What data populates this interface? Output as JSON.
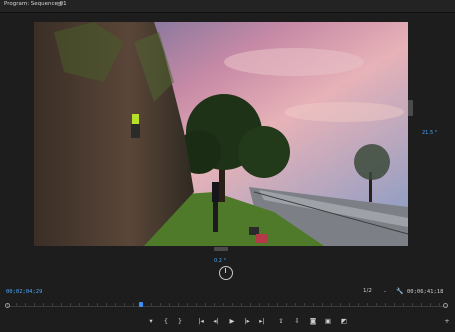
{
  "panel": {
    "title": "Program: Sequence 01",
    "menu_icon": "hamburger-icon",
    "menu_glyph": "≡"
  },
  "viewer": {
    "rotation_right_value": "21.5 °",
    "rotation_bottom_value": "0.2 °"
  },
  "status": {
    "current_timecode": "00;02;04;29",
    "resolution": "1/2",
    "duration_timecode": "00;06;41;18",
    "playhead_fraction": 0.3
  },
  "transport": {
    "buttons": [
      {
        "name": "add-marker-button",
        "glyph": "▾"
      },
      {
        "name": "mark-in-button",
        "glyph": "{"
      },
      {
        "name": "mark-out-button",
        "glyph": "}"
      },
      {
        "name": "go-to-in-button",
        "glyph": "|◂"
      },
      {
        "name": "step-back-button",
        "glyph": "◂|"
      },
      {
        "name": "play-button",
        "glyph": "▶"
      },
      {
        "name": "step-forward-button",
        "glyph": "|▸"
      },
      {
        "name": "go-to-out-button",
        "glyph": "▸|"
      },
      {
        "name": "lift-button",
        "glyph": "⇪"
      },
      {
        "name": "extract-button",
        "glyph": "⇩"
      },
      {
        "name": "export-frame-button",
        "glyph": "◙"
      },
      {
        "name": "comparison-view-button",
        "glyph": "▣"
      },
      {
        "name": "vr-video-button",
        "glyph": "◩"
      },
      {
        "name": "add-button",
        "glyph": "+"
      }
    ]
  },
  "colors": {
    "accent": "#4aa7ff",
    "panel_bg": "#1d1d1d"
  }
}
